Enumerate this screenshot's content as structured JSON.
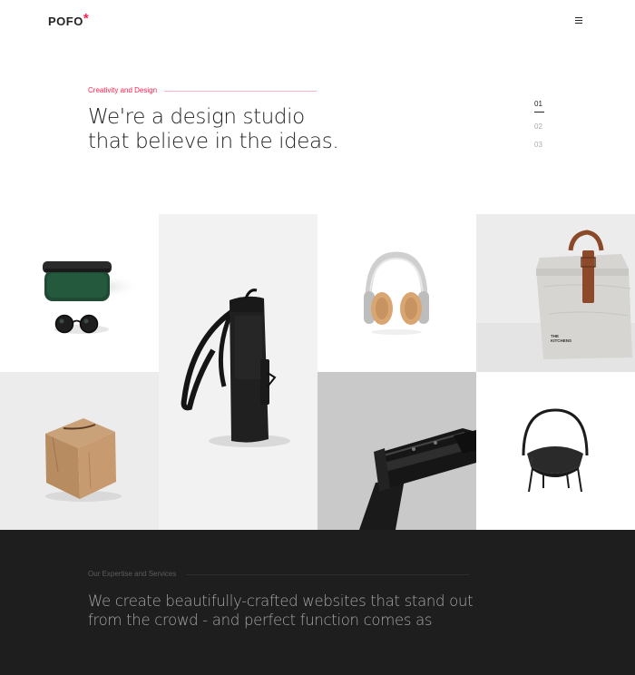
{
  "header": {
    "logo_text": "POFO",
    "logo_star": "*",
    "menu_icon": "hamburger-menu-icon"
  },
  "hero": {
    "kicker": "Creativity and Design",
    "title_line1": "We're a design studio",
    "title_line2": "that believe in the ideas.",
    "slides": [
      "01",
      "02",
      "03"
    ],
    "active_slide": "01"
  },
  "portfolio": {
    "items": [
      {
        "name": "sunglasses-and-case"
      },
      {
        "name": "black-backpack"
      },
      {
        "name": "headphones"
      },
      {
        "name": "paper-bag",
        "print": "THE KITCHENS"
      },
      {
        "name": "wooden-cube"
      },
      {
        "name": "smartwatch"
      },
      {
        "name": "black-chair"
      }
    ]
  },
  "services": {
    "kicker": "Our Expertise and Services",
    "text_line1": "We create beautifully-crafted websites that stand out",
    "text_line2": "from the crowd - and perfect function comes as"
  },
  "colors": {
    "accent": "#ff214f",
    "dark_background": "#1e1e1e",
    "text": "#232323"
  }
}
